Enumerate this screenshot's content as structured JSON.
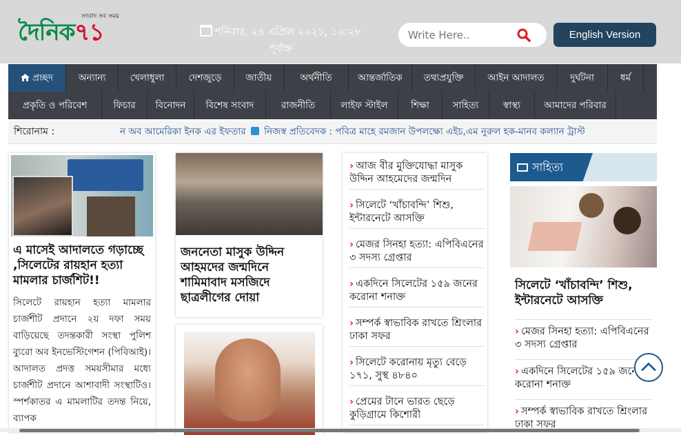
{
  "header": {
    "logo_tagline": "সংবাদ সব সময়",
    "logo_green": "দৈনিক",
    "logo_red": "৭১",
    "date_text": "শনিবার, ২৪ এপ্রিল ২০২১, ১০:২৮ পূর্বাহ্ন",
    "search_placeholder": "Write Here..",
    "english_button": "English Version"
  },
  "nav": {
    "row1": [
      "প্রচ্ছদ",
      "অন্যান্য",
      "খেলাধুলা",
      "দেশজুড়ে",
      "জাতীয়",
      "অর্থনীতি",
      "আন্তর্জাতিক",
      "তথ্যপ্রযুক্তি",
      "আইন আদালত",
      "দুর্ঘটনা",
      "ধর্ম"
    ],
    "row2": [
      "প্রকৃতি ও পরিবেশ",
      "ফিচার",
      "বিনোদন",
      "বিশেষ সংবাদ",
      "রাজনীতি",
      "লাইফ স্টাইল",
      "শিক্ষা",
      "সাহিত্য",
      "স্বাস্থ্য",
      "আমাদের পরিবার"
    ]
  },
  "ticker": {
    "label": "শিরোনাম :",
    "text_a": "ন অব আমেরিকা ইনক এর ইফতার",
    "text_b": "নিজস্ব প্রতিবেদক : পবিত্র মাহে রমজান উপলক্ষ্যে এইচ,এম নুরুল হক-মানব কল্যান ট্রাস্ট"
  },
  "lead": {
    "title": "এ মাসেই আদালতে গড়াচ্ছে ,সিলেটের রায়হান হত্যা মামলার চার্জশিট!!",
    "excerpt": "সিলেটে রায়হান হত্যা মামলার চার্জশীট প্রদানে ২য় দফা সময় বাড়িয়েছে তদন্তকারী সংস্থা পুলিশ ব্যুরো অব ইনভেস্টিগেশন (পিবিআই)। আদালত প্রদত্ত সময়সীমার মধ্যে চার্জশীট প্রদানে আশাবাদী সংস্থাটিও। স্পর্শকাতর এ মামলাটির তদন্ত নিয়ে, ব্যাপক"
  },
  "middle": {
    "title": "জননেতা মাসুক উদ্দিন আহমদের জন্মদিনে শামিমাবাদ মসজিদে ছাত্রলীগের দোয়া"
  },
  "list": [
    "আজ বীর মুক্তিযোদ্ধা মাসুক উদ্দিন আহমেদের জন্মদিন",
    "সিলেটে ‘খাঁচাবন্দি’ শিশু, ইন্টারনেটে আসক্তি",
    "মেজর সিনহা হত্যা: এপিবিএনের ৩ সদস্য গ্রেপ্তার",
    "একদিনে সিলেটের ১৫৯ জনের করোনা শনাক্ত",
    "সম্পর্ক স্বাভাবিক রাখতে শ্রিংলার ঢাকা সফর",
    "সিলেটে করোনায় মৃত্যু বেড়ে ১৭১, সুস্থ ৪৮৪০",
    "প্রেমের টানে ভারত ছেড়ে কুড়িগ্রামে কিশোরী"
  ],
  "sahitya": {
    "header": "সাহিত্য",
    "title": "সিলেটে ‘খাঁচাবন্দি’ শিশু, ইন্টারনেটে আসক্তি",
    "items": [
      "মেজর সিনহা হত্যা: এপিবিএনের ৩ সদস্য গ্রেপ্তার",
      "একদিনে সিলেটের ১৫৯ জনের করোনা শনাক্ত",
      "সম্পর্ক স্বাভাবিক রাখতে শ্রিংলার ঢাকা সফর"
    ]
  },
  "colors": {
    "nav_bg": "#3d4147",
    "nav_active": "#25507a",
    "brand_green": "#0a8a4a",
    "brand_red": "#d0102a",
    "accent_blue": "#1d5b8e"
  }
}
